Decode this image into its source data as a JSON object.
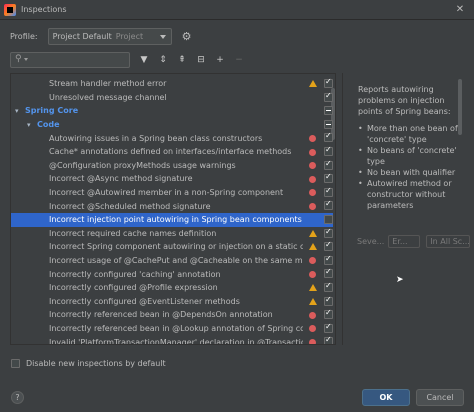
{
  "window": {
    "title": "Inspections"
  },
  "profile": {
    "label": "Profile:",
    "name": "Project Default",
    "scope": "Project"
  },
  "search": {
    "value": "",
    "placeholder": ""
  },
  "toolbar": [
    "filter-icon",
    "expand-all-icon",
    "collapse-all-icon",
    "reset-icon",
    "add-icon",
    "remove-icon"
  ],
  "tree": [
    {
      "label": "Stream handler method error",
      "level": 2,
      "severity": "warning",
      "checked": "on"
    },
    {
      "label": "Unresolved message channel",
      "level": 2,
      "severity": "none",
      "checked": "on"
    },
    {
      "label": "Spring Core",
      "level": 0,
      "group": true,
      "expanded": true,
      "severity": "none",
      "checked": "mixed"
    },
    {
      "label": "Code",
      "level": 1,
      "group": true,
      "expanded": true,
      "severity": "none",
      "checked": "mixed"
    },
    {
      "label": "Autowiring issues in a Spring bean class constructors",
      "level": 2,
      "severity": "error",
      "checked": "on"
    },
    {
      "label": "Cache* annotations defined on interfaces/interface methods",
      "level": 2,
      "severity": "error",
      "checked": "on"
    },
    {
      "label": "@Configuration proxyMethods usage warnings",
      "level": 2,
      "severity": "error",
      "checked": "on"
    },
    {
      "label": "Incorrect @Async method signature",
      "level": 2,
      "severity": "error",
      "checked": "on"
    },
    {
      "label": "Incorrect @Autowired member in a non-Spring component",
      "level": 2,
      "severity": "error",
      "checked": "on"
    },
    {
      "label": "Incorrect @Scheduled method signature",
      "level": 2,
      "severity": "error",
      "checked": "on"
    },
    {
      "label": "Incorrect injection point autowiring in Spring bean components",
      "level": 2,
      "severity": "none",
      "checked": "off",
      "selected": true
    },
    {
      "label": "Incorrect required cache names definition",
      "level": 2,
      "severity": "warning",
      "checked": "on"
    },
    {
      "label": "Incorrect Spring component autowiring or injection on a static cla",
      "level": 2,
      "severity": "warning",
      "checked": "on"
    },
    {
      "label": "Incorrect usage of @CachePut and @Cacheable on the same metho",
      "level": 2,
      "severity": "error",
      "checked": "on"
    },
    {
      "label": "Incorrectly configured 'caching' annotation",
      "level": 2,
      "severity": "error",
      "checked": "on"
    },
    {
      "label": "Incorrectly configured @Profile expression",
      "level": 2,
      "severity": "warning",
      "checked": "on"
    },
    {
      "label": "Incorrectly configured  @EventListener methods",
      "level": 2,
      "severity": "warning",
      "checked": "on"
    },
    {
      "label": "Incorrectly referenced bean in @DependsOn annotation",
      "level": 2,
      "severity": "error",
      "checked": "on"
    },
    {
      "label": "Incorrectly referenced bean in @Lookup annotation of Spring com",
      "level": 2,
      "severity": "error",
      "checked": "on"
    },
    {
      "label": "Invalid 'PlatformTransactionManager' declaration in @Transaction",
      "level": 2,
      "severity": "error",
      "checked": "on"
    }
  ],
  "description": {
    "intro": "Reports autowiring problems on injection points of Spring beans:",
    "bullets": [
      "More than one bean of 'concrete' type",
      "No beans of 'concrete' type",
      "No bean with qualifier",
      "Autowired method or constructor without parameters"
    ],
    "severity_label": "Seve...",
    "severity_value": "Er...",
    "scope_value": "In All Sc..."
  },
  "footer": {
    "disable_new_label": "Disable new inspections by default",
    "help": "?",
    "ok": "OK",
    "cancel": "Cancel"
  },
  "colors": {
    "accent": "#2f65ca",
    "warning": "#e3a21a",
    "error": "#db5c5c",
    "group": "#5394ec"
  }
}
